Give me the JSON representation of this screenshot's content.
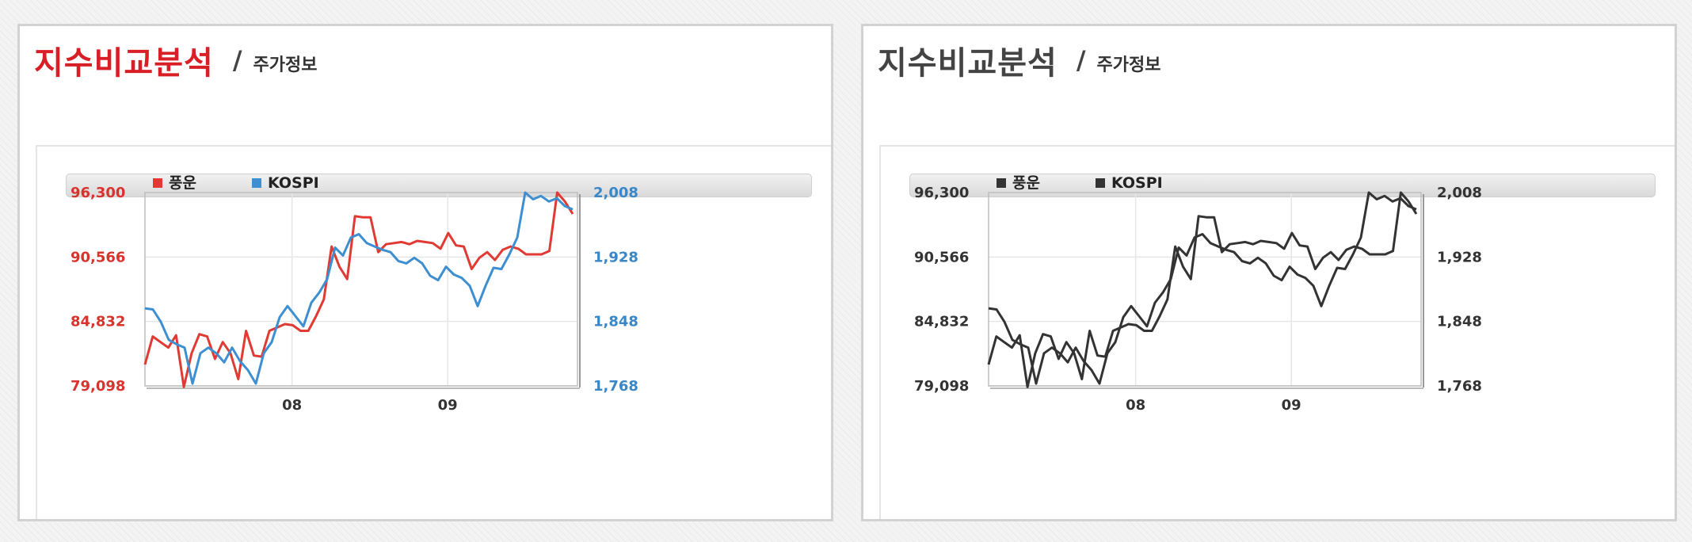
{
  "panels": [
    {
      "title": "지수비교분석",
      "subtitle": "주가정보"
    },
    {
      "title": "지수비교분석",
      "subtitle": "주가정보"
    }
  ],
  "chart_data": [
    {
      "type": "line",
      "title": "",
      "x_tick_labels": [
        "08",
        "09"
      ],
      "left_axis": {
        "ticks": [
          "96,300",
          "90,566",
          "84,832",
          "79,098"
        ],
        "ylim": [
          79098,
          96300
        ],
        "color": "#d9332e"
      },
      "right_axis": {
        "ticks": [
          "2,008",
          "1,928",
          "1,848",
          "1,768"
        ],
        "ylim": [
          1768,
          2008
        ],
        "color": "#3a87c8"
      },
      "legend_position": "top",
      "series": [
        {
          "name": "풍운",
          "color": "#e03a33",
          "axis": "left",
          "values": [
            81000,
            83500,
            83000,
            82500,
            83600,
            79000,
            82000,
            83700,
            83500,
            81500,
            83000,
            82000,
            79700,
            84000,
            81800,
            81700,
            84000,
            84300,
            84600,
            84500,
            84000,
            84000,
            85300,
            86800,
            91500,
            89700,
            88600,
            94200,
            94100,
            94100,
            91000,
            91700,
            91800,
            91900,
            91700,
            92000,
            91900,
            91800,
            91300,
            92700,
            91600,
            91500,
            89500,
            90500,
            91000,
            90300,
            91200,
            91500,
            91300,
            90800,
            90800,
            90800,
            91100,
            96300,
            95500,
            94400
          ]
        },
        {
          "name": "KOSPI",
          "color": "#3d8fd1",
          "axis": "left",
          "values": [
            86000,
            85900,
            84800,
            83200,
            82800,
            82500,
            79300,
            82000,
            82500,
            82000,
            81200,
            82500,
            81300,
            80500,
            79300,
            82000,
            83000,
            85200,
            86200,
            85300,
            84400,
            86500,
            87400,
            88600,
            91400,
            90700,
            92300,
            92600,
            91800,
            91500,
            91200,
            91000,
            90200,
            90000,
            90500,
            90000,
            88900,
            88500,
            89700,
            89000,
            88700,
            88000,
            86200,
            88000,
            89600,
            89500,
            90800,
            92300,
            96300,
            95700,
            96000,
            95500,
            95800,
            95100,
            94800
          ]
        }
      ]
    },
    {
      "type": "line",
      "title": "",
      "x_tick_labels": [
        "08",
        "09"
      ],
      "left_axis": {
        "ticks": [
          "96,300",
          "90,566",
          "84,832",
          "79,098"
        ],
        "ylim": [
          79098,
          96300
        ],
        "color": "#333333"
      },
      "right_axis": {
        "ticks": [
          "2,008",
          "1,928",
          "1,848",
          "1,768"
        ],
        "ylim": [
          1768,
          2008
        ],
        "color": "#333333"
      },
      "legend_position": "top",
      "series": [
        {
          "name": "풍운",
          "color": "#333333",
          "axis": "left",
          "values": [
            81000,
            83500,
            83000,
            82500,
            83600,
            79000,
            82000,
            83700,
            83500,
            81500,
            83000,
            82000,
            79700,
            84000,
            81800,
            81700,
            84000,
            84300,
            84600,
            84500,
            84000,
            84000,
            85300,
            86800,
            91500,
            89700,
            88600,
            94200,
            94100,
            94100,
            91000,
            91700,
            91800,
            91900,
            91700,
            92000,
            91900,
            91800,
            91300,
            92700,
            91600,
            91500,
            89500,
            90500,
            91000,
            90300,
            91200,
            91500,
            91300,
            90800,
            90800,
            90800,
            91100,
            96300,
            95500,
            94400
          ]
        },
        {
          "name": "KOSPI",
          "color": "#333333",
          "axis": "left",
          "values": [
            86000,
            85900,
            84800,
            83200,
            82800,
            82500,
            79300,
            82000,
            82500,
            82000,
            81200,
            82500,
            81300,
            80500,
            79300,
            82000,
            83000,
            85200,
            86200,
            85300,
            84400,
            86500,
            87400,
            88600,
            91400,
            90700,
            92300,
            92600,
            91800,
            91500,
            91200,
            91000,
            90200,
            90000,
            90500,
            90000,
            88900,
            88500,
            89700,
            89000,
            88700,
            88000,
            86200,
            88000,
            89600,
            89500,
            90800,
            92300,
            96300,
            95700,
            96000,
            95500,
            95800,
            95100,
            94800
          ]
        }
      ]
    }
  ],
  "colors": {
    "left_title": "#d81f26",
    "right_title": "#444444"
  }
}
